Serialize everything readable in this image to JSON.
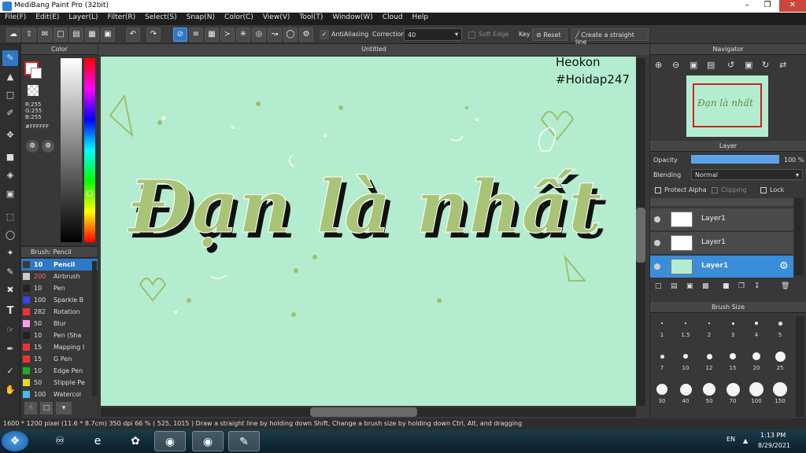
{
  "window": {
    "title": "MediBang Paint Pro (32bit)"
  },
  "menu": [
    "File(F)",
    "Edit(E)",
    "Layer(L)",
    "Filter(R)",
    "Select(S)",
    "Snap(N)",
    "Color(C)",
    "View(V)",
    "Tool(T)",
    "Window(W)",
    "Cloud",
    "Help"
  ],
  "toolbar": {
    "antialiasing": "AntiAliasing",
    "correction_label": "Correction",
    "correction_value": "40",
    "soft_edge": "Soft Edge",
    "key": "Key",
    "reset": "Reset",
    "straight_line": "Create a straight line"
  },
  "color_panel": {
    "title": "Color",
    "r": "R:255",
    "g": "G:255",
    "b": "B:255",
    "hex": "#FFFFFF"
  },
  "brush_panel": {
    "title": "Brush: Pencil",
    "brushes": [
      {
        "size": "10",
        "name": "Pencil",
        "color": "#3a3a3a"
      },
      {
        "size": "200",
        "name": "Airbrush",
        "color": "#c8c8c8"
      },
      {
        "size": "10",
        "name": "Pen",
        "color": "#222222"
      },
      {
        "size": "100",
        "name": "Sparkle B",
        "color": "#3344ee"
      },
      {
        "size": "282",
        "name": "Rotation",
        "color": "#ee3333"
      },
      {
        "size": "50",
        "name": "Blur",
        "color": "#ff99ee"
      },
      {
        "size": "10",
        "name": "Pen (Sha",
        "color": "#222222"
      },
      {
        "size": "15",
        "name": "Mapping I",
        "color": "#ee3333"
      },
      {
        "size": "15",
        "name": "G Pen",
        "color": "#ee3333"
      },
      {
        "size": "10",
        "name": "Edge Pen",
        "color": "#22aa22"
      },
      {
        "size": "50",
        "name": "Stipple Pe",
        "color": "#dddd22"
      },
      {
        "size": "100",
        "name": "Watercol",
        "color": "#44bbee"
      }
    ]
  },
  "canvas": {
    "tab": "Untitled",
    "bg_color": "#b4eccf",
    "main_text": "Đạn là nhất",
    "watermark_line1": "Heokon",
    "watermark_line2": "#Hoidap247"
  },
  "navigator": {
    "title": "Navigator"
  },
  "layer_panel": {
    "title": "Layer",
    "opacity_label": "Opacity",
    "opacity_value": "100 %",
    "opacity_fraction": 1.0,
    "blending_label": "Blending",
    "blending_value": "Normal",
    "protect_alpha": "Protect Alpha",
    "clipping": "Clipping",
    "lock": "Lock",
    "layers": [
      {
        "name": "Layer1"
      },
      {
        "name": "Layer1"
      },
      {
        "name": "Layer1"
      }
    ]
  },
  "brush_size": {
    "title": "Brush Size",
    "sizes": [
      "1",
      "1.5",
      "2",
      "3",
      "4",
      "5",
      "7",
      "10",
      "12",
      "15",
      "20",
      "25",
      "30",
      "40",
      "50",
      "70",
      "100",
      "150"
    ]
  },
  "status": {
    "dimensions": "1600 * 1200 pixel",
    "cm": "(11.6 * 8.7cm)",
    "dpi": "350 dpi",
    "zoom": "66 %",
    "coords": "( 525, 1015 )",
    "hint": "Draw a straight line by holding down Shift, Change a brush size by holding down Ctrl, Alt, and dragging"
  },
  "taskbar": {
    "lang": "EN",
    "time": "1:13 PM",
    "date": "8/29/2021"
  }
}
